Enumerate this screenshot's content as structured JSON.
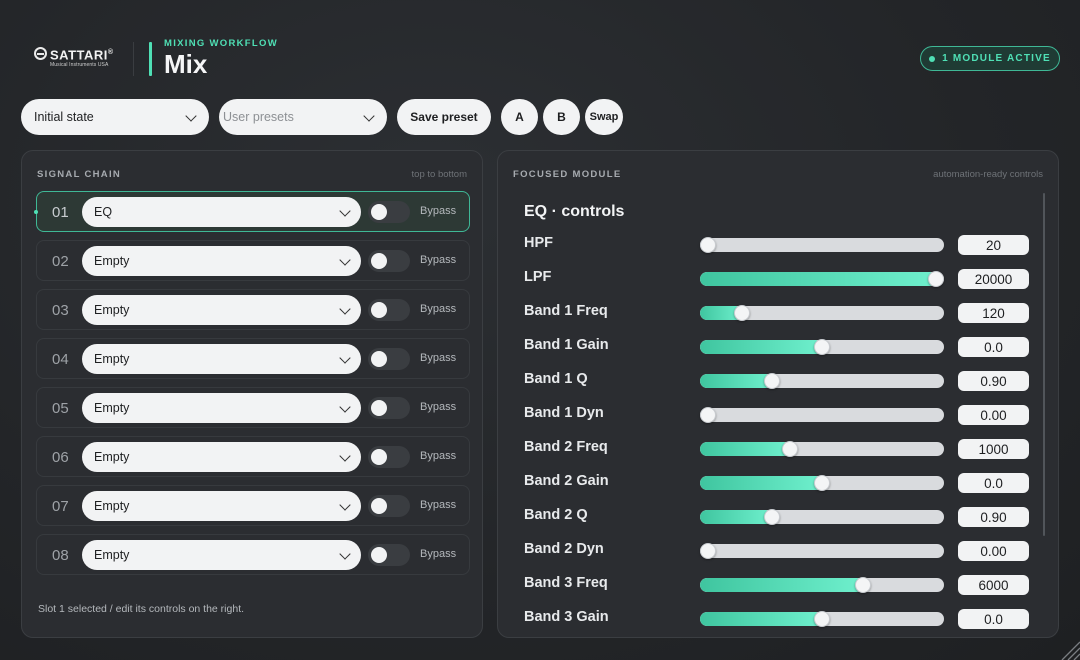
{
  "header": {
    "brand": "SATTARI",
    "brand_mark": "®",
    "brand_sub": "Musical Instruments USA",
    "eyebrow": "MIXING WORKFLOW",
    "title": "Mix",
    "active_badge": "1 MODULE ACTIVE"
  },
  "toolbar": {
    "state_select": "Initial state",
    "presets_placeholder": "User presets",
    "save_label": "Save preset",
    "a_label": "A",
    "b_label": "B",
    "swap_label": "Swap"
  },
  "signal_chain": {
    "title": "SIGNAL CHAIN",
    "hint": "top to bottom",
    "slots": [
      {
        "num": "01",
        "module": "EQ",
        "bypass_label": "Bypass",
        "bypassed": false,
        "selected": true
      },
      {
        "num": "02",
        "module": "Empty",
        "bypass_label": "Bypass",
        "bypassed": false,
        "selected": false
      },
      {
        "num": "03",
        "module": "Empty",
        "bypass_label": "Bypass",
        "bypassed": false,
        "selected": false
      },
      {
        "num": "04",
        "module": "Empty",
        "bypass_label": "Bypass",
        "bypassed": false,
        "selected": false
      },
      {
        "num": "05",
        "module": "Empty",
        "bypass_label": "Bypass",
        "bypassed": false,
        "selected": false
      },
      {
        "num": "06",
        "module": "Empty",
        "bypass_label": "Bypass",
        "bypassed": false,
        "selected": false
      },
      {
        "num": "07",
        "module": "Empty",
        "bypass_label": "Bypass",
        "bypassed": false,
        "selected": false
      },
      {
        "num": "08",
        "module": "Empty",
        "bypass_label": "Bypass",
        "bypassed": false,
        "selected": false
      }
    ],
    "footer": "Slot 1 selected / edit its controls on the right."
  },
  "focused_module": {
    "title": "FOCUSED MODULE",
    "hint": "automation-ready controls",
    "heading": "EQ · controls",
    "params": [
      {
        "label": "HPF",
        "value": "20",
        "level": 0.0
      },
      {
        "label": "LPF",
        "value": "20000",
        "level": 1.0
      },
      {
        "label": "Band 1 Freq",
        "value": "120",
        "level": 0.15
      },
      {
        "label": "Band 1 Gain",
        "value": "0.0",
        "level": 0.5
      },
      {
        "label": "Band 1 Q",
        "value": "0.90",
        "level": 0.28
      },
      {
        "label": "Band 1 Dyn",
        "value": "0.00",
        "level": 0.0
      },
      {
        "label": "Band 2 Freq",
        "value": "1000",
        "level": 0.36
      },
      {
        "label": "Band 2 Gain",
        "value": "0.0",
        "level": 0.5
      },
      {
        "label": "Band 2 Q",
        "value": "0.90",
        "level": 0.28
      },
      {
        "label": "Band 2 Dyn",
        "value": "0.00",
        "level": 0.0
      },
      {
        "label": "Band 3 Freq",
        "value": "6000",
        "level": 0.68
      },
      {
        "label": "Band 3 Gain",
        "value": "0.0",
        "level": 0.5
      }
    ]
  },
  "colors": {
    "accent": "#4fe0b5",
    "background": "#232528",
    "panel": "#2b2d31"
  }
}
